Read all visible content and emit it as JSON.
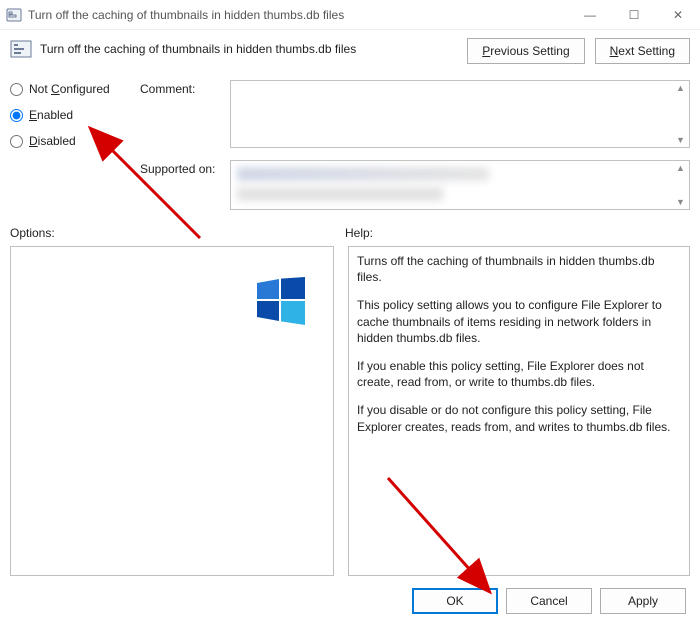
{
  "window": {
    "title": "Turn off the caching of thumbnails in hidden thumbs.db files"
  },
  "header": {
    "policy_title": "Turn off the caching of thumbnails in hidden thumbs.db files",
    "prev_label_pre": "",
    "prev_mnemonic": "P",
    "prev_label_post": "revious Setting",
    "next_mnemonic": "N",
    "next_label_post": "ext Setting"
  },
  "state": {
    "not_configured_pre": "Not ",
    "not_configured_mn": "C",
    "not_configured_post": "onfigured",
    "enabled_mn": "E",
    "enabled_post": "nabled",
    "disabled_mn": "D",
    "disabled_post": "isabled",
    "selected": "enabled"
  },
  "fields": {
    "comment_label": "Comment:",
    "comment_value": "",
    "supported_label": "Supported on:"
  },
  "panes": {
    "options_label": "Options:",
    "help_label": "Help:"
  },
  "help": {
    "p1": "Turns off the caching of thumbnails in hidden thumbs.db files.",
    "p2": "This policy setting allows you to configure File Explorer to cache thumbnails of items residing in network folders in hidden thumbs.db files.",
    "p3": "If you enable this policy setting, File Explorer does not create, read from, or write to thumbs.db files.",
    "p4": "If you disable or do not configure this policy setting, File Explorer creates, reads from, and writes to thumbs.db files."
  },
  "footer": {
    "ok": "OK",
    "cancel": "Cancel",
    "apply": "Apply"
  },
  "win_controls": {
    "min": "—",
    "max": "☐",
    "close": "✕"
  }
}
